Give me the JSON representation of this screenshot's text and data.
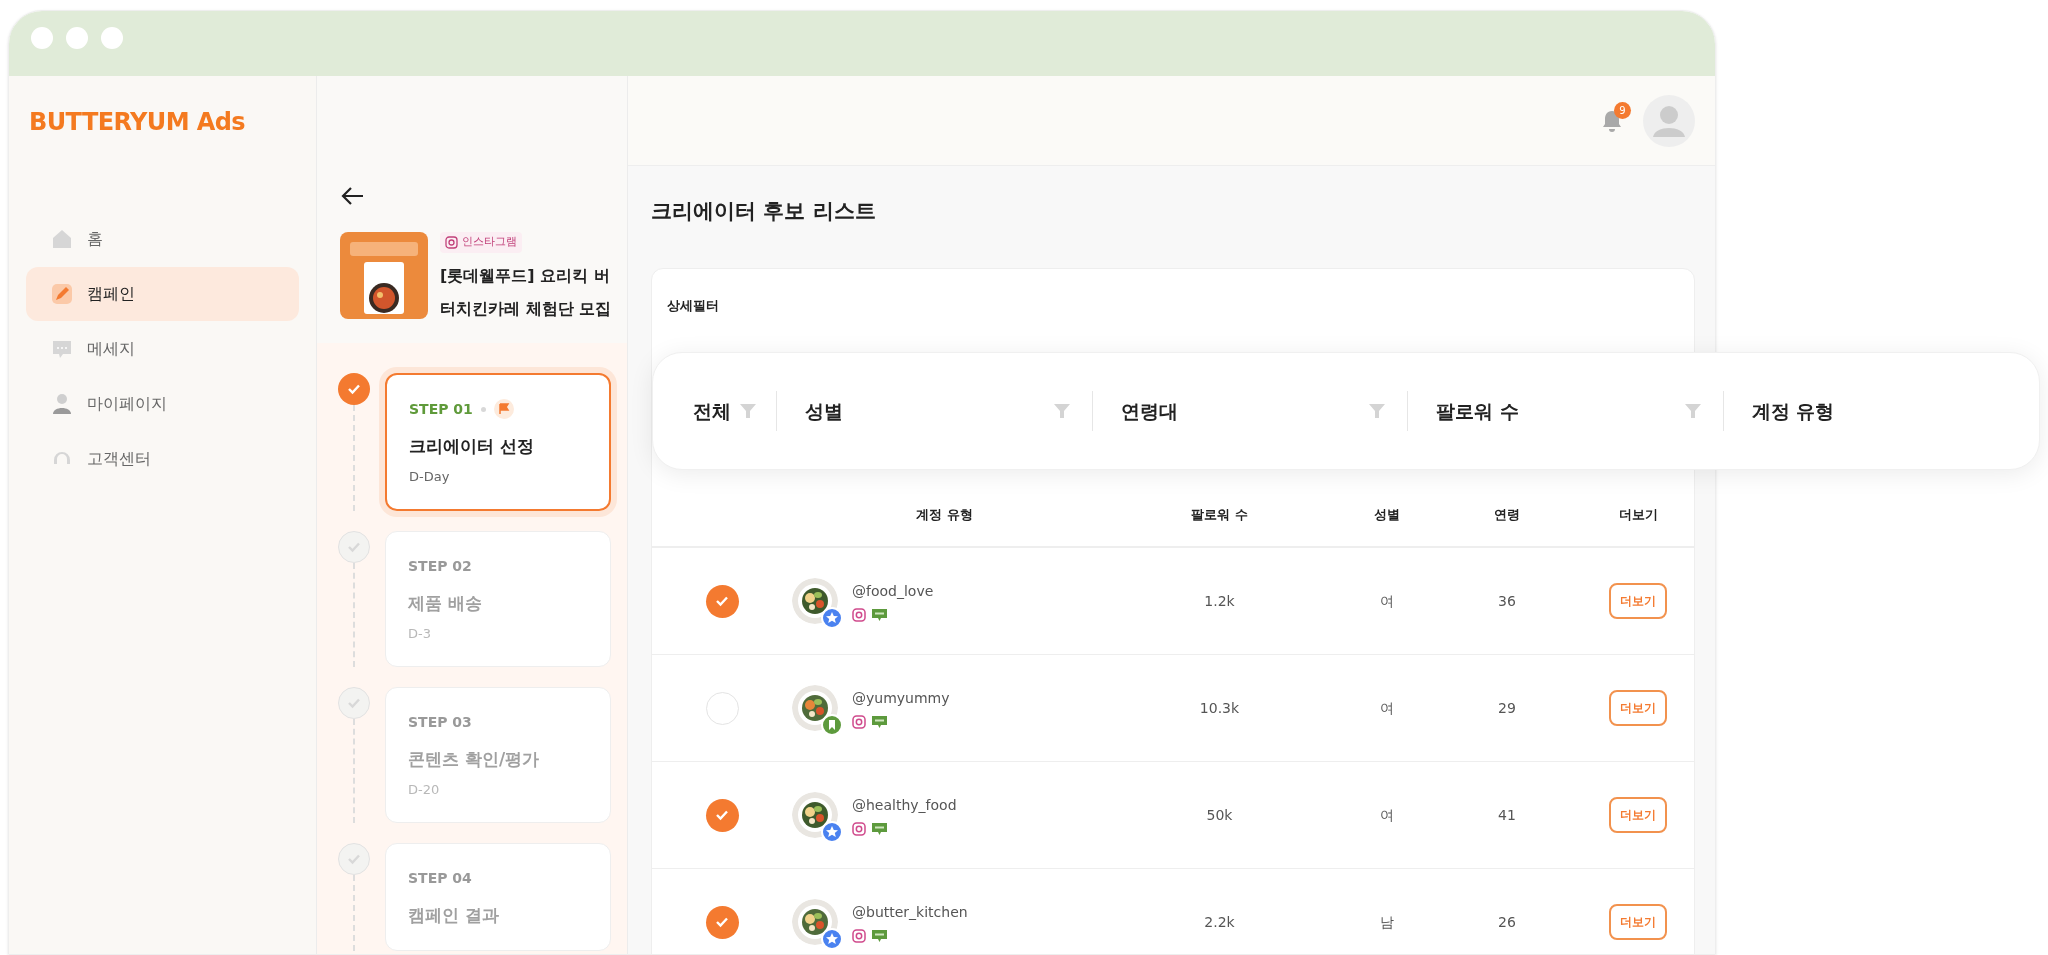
{
  "sidebar": {
    "logo": "BUTTERYUM Ads",
    "items": [
      {
        "label": "홈",
        "selected": false
      },
      {
        "label": "캠페인",
        "selected": true
      },
      {
        "label": "메세지",
        "selected": false
      },
      {
        "label": "마이페이지",
        "selected": false
      },
      {
        "label": "고객센터",
        "selected": false
      }
    ]
  },
  "campaign": {
    "platform": "인스타그램",
    "title": "[롯데웰푸드] 요리킥 버터치킨카레 체험단 모집"
  },
  "steps": [
    {
      "step": "STEP 01",
      "title": "크리에이터 선정",
      "due": "D-Day",
      "selected": true,
      "done": true
    },
    {
      "step": "STEP 02",
      "title": "제품 배송",
      "due": "D-3",
      "selected": false,
      "done": false
    },
    {
      "step": "STEP 03",
      "title": "콘텐츠 확인/평가",
      "due": "D-20",
      "selected": false,
      "done": false
    },
    {
      "step": "STEP 04",
      "title": "캠페인 결과",
      "selected": false,
      "done": false
    }
  ],
  "header": {
    "notifications": "9"
  },
  "page_title": "크리에이터 후보 리스트",
  "filter": {
    "title": "상세필터",
    "options": [
      "전체",
      "성별",
      "연령대",
      "팔로워 수",
      "계정 유형"
    ]
  },
  "table": {
    "columns": [
      "계정 유형",
      "팔로워 수",
      "성별",
      "연령",
      "더보기"
    ],
    "rows": [
      {
        "selected": true,
        "handle": "@food_love",
        "kind": "star",
        "followers": "1.2k",
        "gender": "여",
        "age": "36",
        "action": "더보기"
      },
      {
        "selected": false,
        "handle": "@yumyummy",
        "kind": "bookmark",
        "followers": "10.3k",
        "gender": "여",
        "age": "29",
        "action": "더보기"
      },
      {
        "selected": true,
        "handle": "@healthy_food",
        "kind": "star",
        "followers": "50k",
        "gender": "여",
        "age": "41",
        "action": "더보기"
      },
      {
        "selected": true,
        "handle": "@butter_kitchen",
        "kind": "star",
        "followers": "2.2k",
        "gender": "남",
        "age": "26",
        "action": "더보기"
      }
    ]
  }
}
